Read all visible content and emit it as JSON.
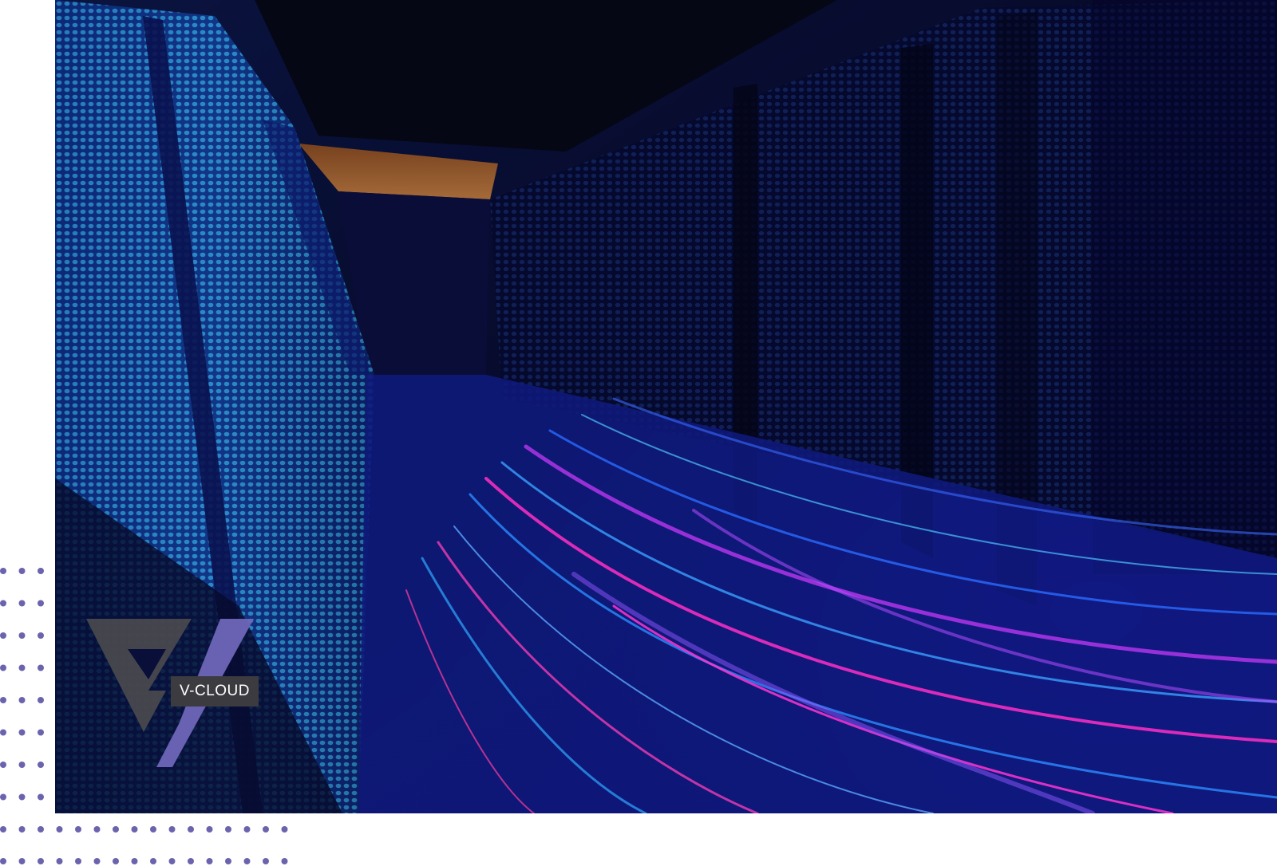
{
  "brand": {
    "name": "V-CLOUD",
    "logo_primary_color": "#4a4a4e",
    "logo_accent_color": "#6f66b8"
  },
  "image": {
    "subject": "server-room-corridor-with-light-trails"
  },
  "colors": {
    "dot_pattern": "#6b63ad",
    "background": "#ffffff"
  }
}
